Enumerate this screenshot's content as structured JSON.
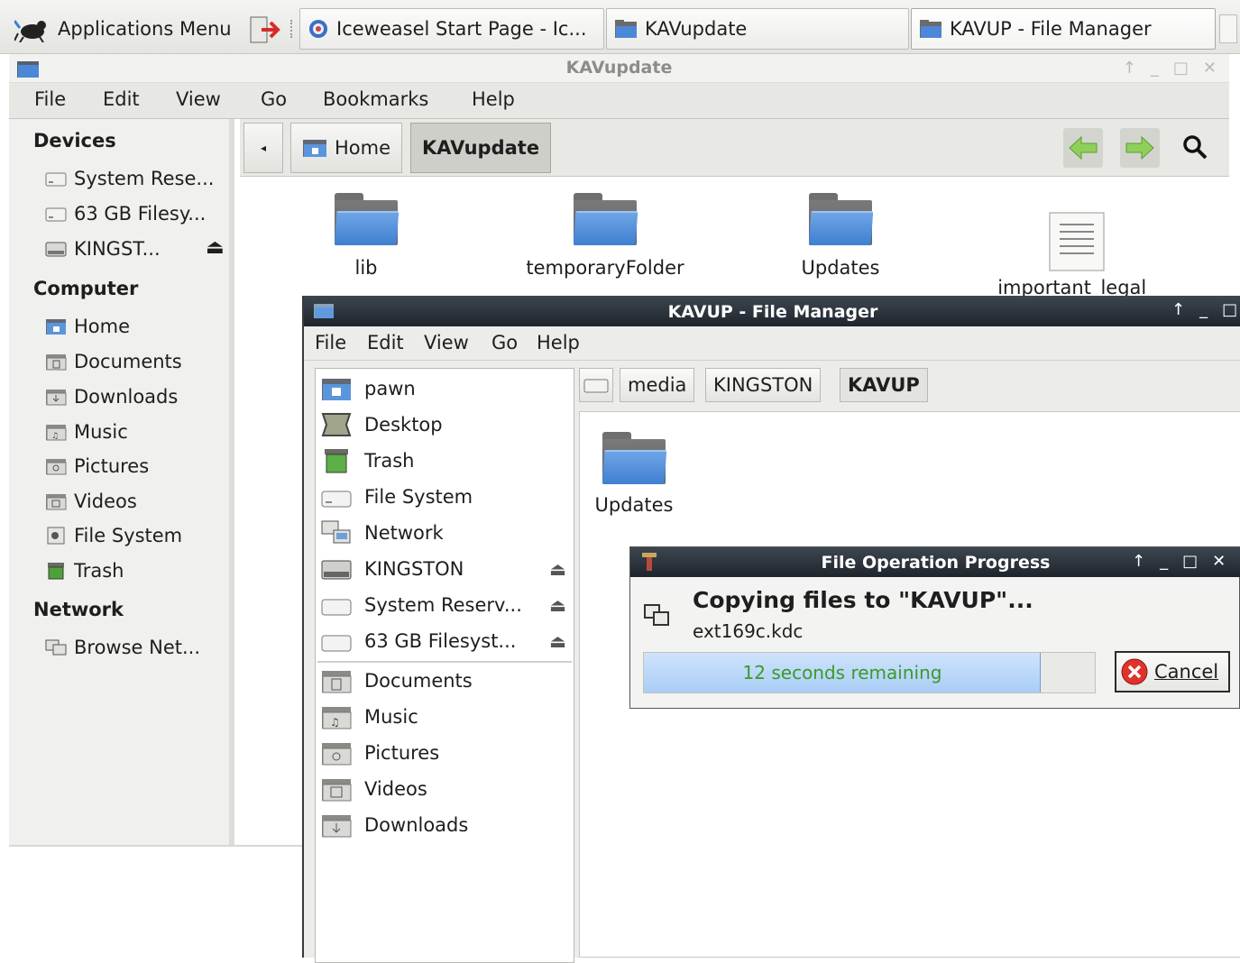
{
  "taskbar": {
    "app_menu": "Applications Menu",
    "tasks": [
      {
        "label": "Iceweasel Start Page - Ic..."
      },
      {
        "label": "KAVupdate"
      },
      {
        "label": "KAVUP - File Manager"
      }
    ]
  },
  "main_window": {
    "title": "KAVupdate",
    "menu": [
      "File",
      "Edit",
      "View",
      "Go",
      "Bookmarks",
      "Help"
    ],
    "sidebar": {
      "devices_heading": "Devices",
      "devices": [
        "System Rese...",
        "63 GB Filesy...",
        "KINGST..."
      ],
      "computer_heading": "Computer",
      "computer": [
        "Home",
        "Documents",
        "Downloads",
        "Music",
        "Pictures",
        "Videos",
        "File System",
        "Trash"
      ],
      "network_heading": "Network",
      "network": [
        "Browse Net..."
      ]
    },
    "breadcrumbs": [
      "Home",
      "KAVupdate"
    ],
    "files": [
      {
        "name": "lib",
        "type": "folder"
      },
      {
        "name": "temporaryFolder",
        "type": "folder"
      },
      {
        "name": "Updates",
        "type": "folder"
      },
      {
        "name": "important_legal_\nnotice.txt",
        "type": "text"
      }
    ]
  },
  "kavup_window": {
    "title": "KAVUP - File Manager",
    "menu": [
      "File",
      "Edit",
      "View",
      "Go",
      "Help"
    ],
    "sidebar": [
      {
        "label": "pawn",
        "icon": "home-icon"
      },
      {
        "label": "Desktop",
        "icon": "desktop-icon"
      },
      {
        "label": "Trash",
        "icon": "trash-icon"
      },
      {
        "label": "File System",
        "icon": "drive-icon"
      },
      {
        "label": "Network",
        "icon": "network-icon"
      },
      {
        "label": "KINGSTON",
        "icon": "usb-drive-icon",
        "eject": true
      },
      {
        "label": "System Reserv...",
        "icon": "drive-icon",
        "eject": true
      },
      {
        "label": "63 GB Filesyst...",
        "icon": "drive-icon",
        "eject": true
      },
      {
        "label": "Documents",
        "icon": "documents-folder-icon"
      },
      {
        "label": "Music",
        "icon": "music-folder-icon"
      },
      {
        "label": "Pictures",
        "icon": "pictures-folder-icon"
      },
      {
        "label": "Videos",
        "icon": "videos-folder-icon"
      },
      {
        "label": "Downloads",
        "icon": "downloads-folder-icon"
      }
    ],
    "path": [
      "media",
      "KINGSTON",
      "KAVUP"
    ],
    "files": [
      {
        "name": "Updates",
        "type": "folder"
      }
    ]
  },
  "progress_dialog": {
    "title": "File Operation Progress",
    "heading": "Copying files to \"KAVUP\"...",
    "current_file": "ext169c.kdc",
    "remaining": "12 seconds remaining",
    "progress_fraction": 0.88,
    "cancel_label": "Cancel"
  }
}
